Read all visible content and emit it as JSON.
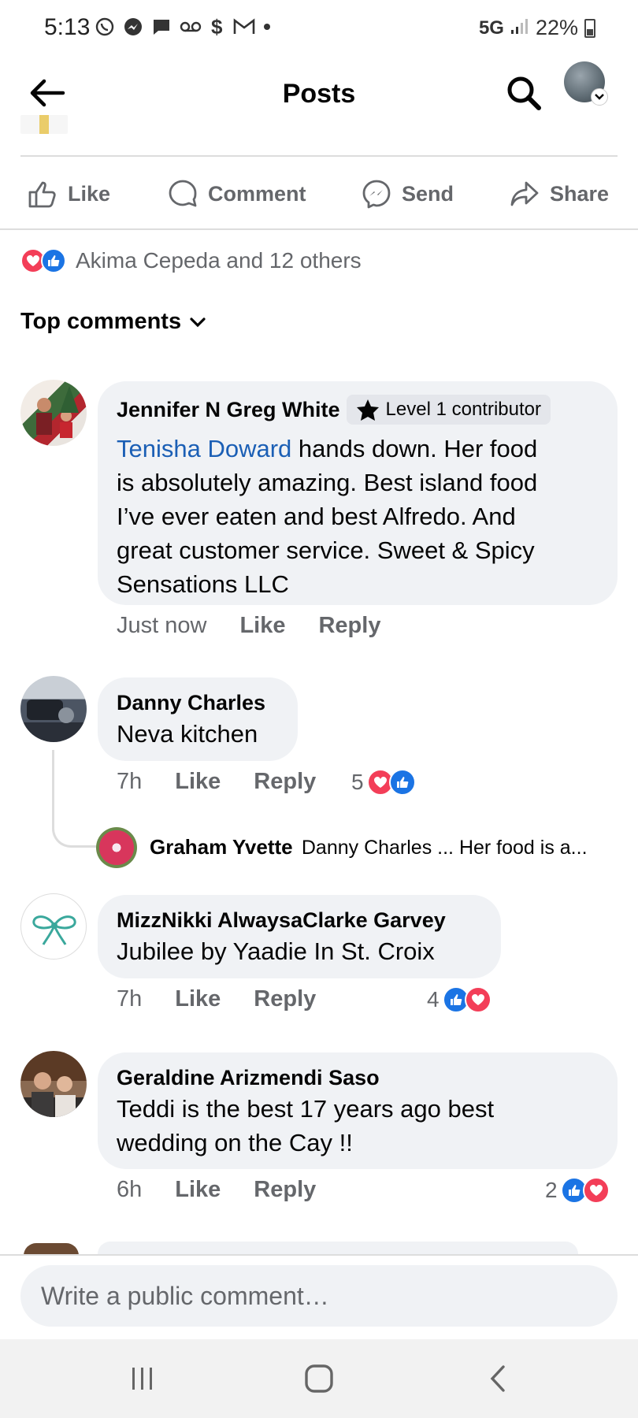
{
  "status_bar": {
    "time": "5:13",
    "signal": "5G",
    "battery": "22%",
    "icons": [
      "whatsapp-icon",
      "messenger-icon",
      "message-icon",
      "voicemail-icon",
      "dollar-icon",
      "gmail-icon",
      "dot-icon"
    ]
  },
  "header": {
    "title": "Posts"
  },
  "actions": {
    "like": "Like",
    "comment": "Comment",
    "send": "Send",
    "share": "Share"
  },
  "reactions": {
    "summary": "Akima Cepeda and 12 others"
  },
  "top_comments": {
    "label": "Top comments"
  },
  "comments": [
    {
      "name": "Jennifer N Greg White",
      "badge": "Level 1 contributor",
      "mention": "Tenisha Doward",
      "text_line1_rest": " hands down.  Her food",
      "text_lines": [
        "is absolutely amazing.  Best island food",
        "I’ve ever eaten and best Alfredo.  And",
        "great customer service. Sweet & Spicy",
        "Sensations LLC"
      ],
      "time": "Just now",
      "like": "Like",
      "reply": "Reply"
    },
    {
      "name": "Danny Charles",
      "text": "Neva kitchen",
      "time": "7h",
      "like": "Like",
      "reply": "Reply",
      "reaction_count": "5"
    },
    {
      "name": "MizzNikki AlwaysaClarke Garvey",
      "text": "Jubilee by Yaadie In St. Croix",
      "time": "7h",
      "like": "Like",
      "reply": "Reply",
      "reaction_count": "4"
    },
    {
      "name": "Geraldine Arizmendi Saso",
      "text_lines": [
        "Teddi is the best 17 years ago best",
        "wedding on the Cay !!"
      ],
      "time": "6h",
      "like": "Like",
      "reply": "Reply",
      "reaction_count": "2"
    }
  ],
  "reply_preview": {
    "name": "Graham Yvette",
    "text": "Danny Charles ... Her food is a..."
  },
  "comment_input": {
    "placeholder": "Write a public comment…"
  },
  "colors": {
    "accent_blue": "#1b74e4",
    "mention_blue": "#1b5fb5",
    "love_red": "#f33e58",
    "bubble_bg": "#f0f2f5",
    "secondary_text": "#65676b"
  }
}
